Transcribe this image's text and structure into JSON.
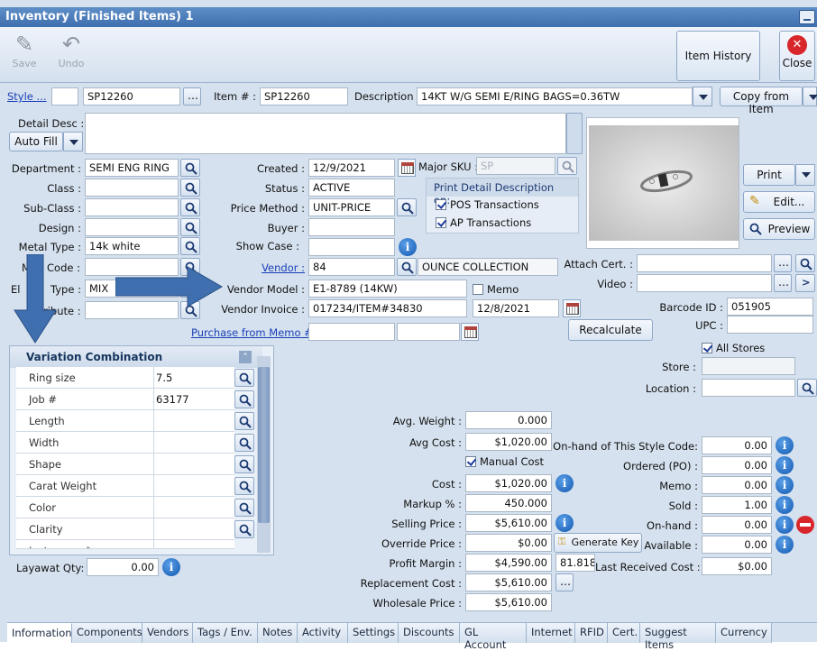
{
  "window": {
    "title": "Inventory (Finished Items) 1"
  },
  "toolbar": {
    "save": "Save",
    "undo": "Undo",
    "item_history": "Item History",
    "close": "Close"
  },
  "header": {
    "style_link": "Style ...",
    "style_value": "SP12260",
    "item_label": "Item # :",
    "item_value": "SP12260",
    "desc_label": "Description :",
    "desc_value": "14KT W/G SEMI E/RING BAGS=0.36TW",
    "copy_from_item": "Copy from Item"
  },
  "detail": {
    "detail_desc_label": "Detail Desc :",
    "auto_fill": "Auto Fill"
  },
  "left": {
    "department_label": "Department :",
    "department": "SEMI ENG RING",
    "class_label": "Class :",
    "class": "",
    "subclass_label": "Sub-Class :",
    "subclass": "",
    "design_label": "Design :",
    "design": "",
    "metal_type_label": "Metal Type :",
    "metal_type": "14k white",
    "code_label_a": "M",
    "code_label_b": "Code :",
    "code": "",
    "el_type_label_a": "El",
    "el_type_label_b": "Type :",
    "el_type": "MIX",
    "attribute_label": "ribute :",
    "attribute": ""
  },
  "middle": {
    "created_label": "Created :",
    "created": "12/9/2021",
    "status_label": "Status :",
    "status": "ACTIVE",
    "price_method_label": "Price Method :",
    "price_method": "UNIT-PRICE",
    "buyer_label": "Buyer :",
    "buyer": "",
    "show_case_label": "Show Case :",
    "show_case": "",
    "vendor_label": "Vendor :",
    "vendor": "84",
    "vendor_name": "OUNCE COLLECTION",
    "vendor_model_label": "Vendor Model :",
    "vendor_model": "E1-8789 (14KW)",
    "memo": "Memo",
    "vendor_invoice_label": "Vendor Invoice :",
    "vendor_invoice": "017234/ITEM#34830",
    "invoice_date": "12/8/2021",
    "purchase_memo_label": "Purchase from Memo # :"
  },
  "major_sku": {
    "label": "Major SKU :",
    "value": "SP"
  },
  "print_detail": {
    "title": "Print Detail Description on:",
    "pos": "POS Transactions",
    "ap": "AP Transactions"
  },
  "photo_buttons": {
    "print": "Print",
    "edit": "Edit...",
    "preview": "Preview"
  },
  "right": {
    "attach_cert_label": "Attach Cert. :",
    "video_label": "Video :",
    "barcode_label": "Barcode ID :",
    "barcode": "051905",
    "upc_label": "UPC :",
    "upc": "",
    "recalculate": "Recalculate",
    "all_stores": "All Stores",
    "store_label": "Store :",
    "location_label": "Location :"
  },
  "variation": {
    "title": "Variation Combination",
    "rows": [
      {
        "name": "Ring size",
        "value": "7.5"
      },
      {
        "name": "Job #",
        "value": "63177"
      },
      {
        "name": "Length",
        "value": ""
      },
      {
        "name": "Width",
        "value": ""
      },
      {
        "name": "Shape",
        "value": ""
      },
      {
        "name": "Carat Weight",
        "value": ""
      },
      {
        "name": "Color",
        "value": ""
      },
      {
        "name": "Clarity",
        "value": ""
      },
      {
        "name": "Instagram $",
        "value": ""
      }
    ]
  },
  "layaway": {
    "label": "Layawat Qty:",
    "value": "0.00"
  },
  "pricing": {
    "avg_weight_label": "Avg. Weight :",
    "avg_weight": "0.000",
    "avg_cost_label": "Avg Cost :",
    "avg_cost": "$1,020.00",
    "manual_cost": "Manual Cost",
    "cost_label": "Cost :",
    "cost": "$1,020.00",
    "markup_label": "Markup % :",
    "markup": "450.000",
    "selling_label": "Selling Price :",
    "selling": "$5,610.00",
    "override_label": "Override Price :",
    "override": "$0.00",
    "generate_key": "Generate Key",
    "profit_label": "Profit Margin :",
    "profit": "$4,590.00",
    "profit_pct": "81.818",
    "replacement_label": "Replacement Cost :",
    "replacement": "$5,610.00",
    "wholesale_label": "Wholesale Price :",
    "wholesale": "$5,610.00"
  },
  "stock": {
    "onhand_style_label": "On-hand of This Style Code:",
    "onhand_style": "0.00",
    "ordered_label": "Ordered (PO) :",
    "ordered": "0.00",
    "memo_label": "Memo :",
    "memo": "0.00",
    "sold_label": "Sold :",
    "sold": "1.00",
    "onhand_label": "On-hand :",
    "onhand": "0.00",
    "available_label": "Available :",
    "available": "0.00",
    "last_received_label": "Last Received Cost :",
    "last_received": "$0.00"
  },
  "tabs": [
    "Information",
    "Components",
    "Vendors",
    "Tags / Env.",
    "Notes",
    "Activity",
    "Settings",
    "Discounts",
    "GL Account",
    "Internet",
    "RFID",
    "Cert.",
    "Suggest Items",
    "Currency"
  ],
  "colors": {
    "titlebar": "#4a7cbc",
    "panel": "#d5e1ee",
    "arrow": "#3f6fae",
    "link": "#1a3fb8"
  }
}
